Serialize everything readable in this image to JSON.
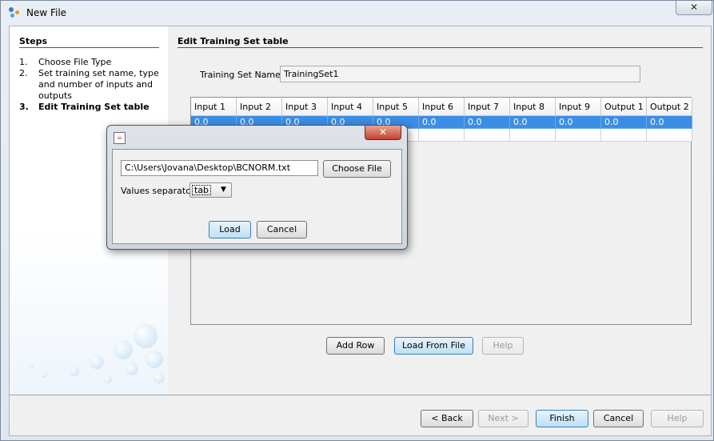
{
  "window": {
    "title": "New File",
    "close_glyph": "✕"
  },
  "steps": {
    "title": "Steps",
    "items": [
      {
        "num": "1.",
        "label": "Choose File Type"
      },
      {
        "num": "2.",
        "label": "Set training set name, type and number of inputs and outputs"
      },
      {
        "num": "3.",
        "label": "Edit Training Set table"
      }
    ]
  },
  "main": {
    "title": "Edit Training Set table",
    "training_set_name_label": "Training Set Name:",
    "training_set_name_value": "TrainingSet1",
    "table": {
      "headers": [
        "Input 1",
        "Input 2",
        "Input 3",
        "Input 4",
        "Input 5",
        "Input 6",
        "Input 7",
        "Input 8",
        "Input 9",
        "Output 1",
        "Output 2"
      ],
      "rows": [
        [
          "0.0",
          "0.0",
          "0.0",
          "0.0",
          "0.0",
          "0.0",
          "0.0",
          "0.0",
          "0.0",
          "0.0",
          "0.0"
        ],
        [
          "",
          "",
          "",
          "",
          "",
          "",
          "",
          "",
          "",
          "",
          ""
        ]
      ]
    },
    "buttons": {
      "add_row": "Add Row",
      "load_from_file": "Load From File",
      "help": "Help"
    }
  },
  "footer": {
    "back": "< Back",
    "next": "Next >",
    "finish": "Finish",
    "cancel": "Cancel",
    "help": "Help"
  },
  "dialog": {
    "close_glyph": "✕",
    "file_path": "C:\\Users\\Jovana\\Desktop\\BCNORM.txt",
    "choose_file": "Choose File",
    "values_separator_label": "Values separator",
    "values_separator_value": "tab",
    "load": "Load",
    "cancel": "Cancel"
  },
  "colors": {
    "selection": "#3a8ee6",
    "primary_button": "#bfe0f5",
    "dialog_close": "#c4422b"
  }
}
